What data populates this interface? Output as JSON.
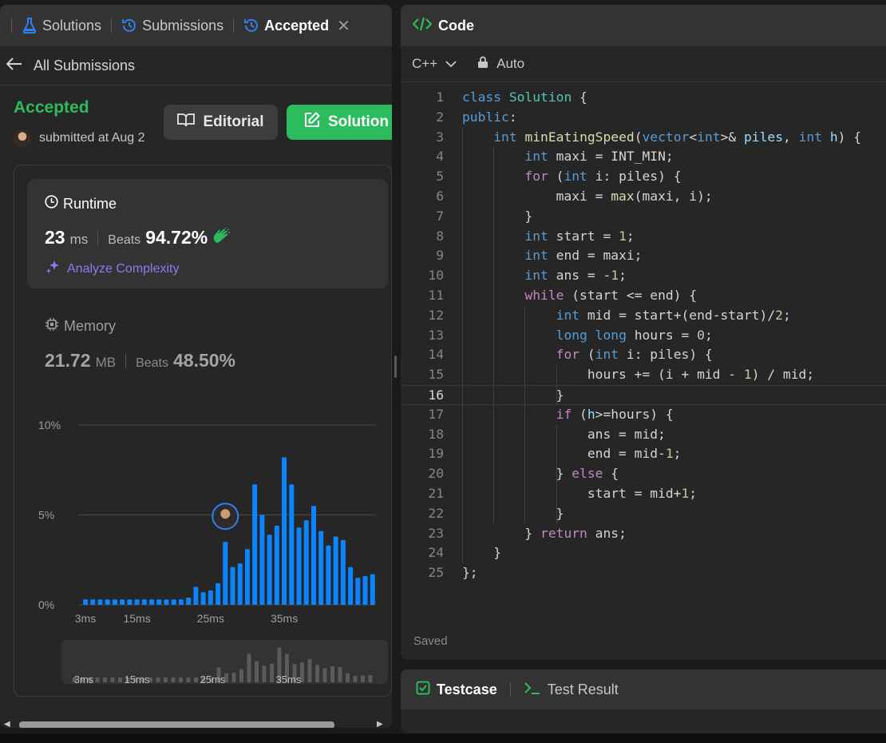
{
  "left_tabs": [
    {
      "label": "Solutions",
      "icon": "flask-icon"
    },
    {
      "label": "Submissions",
      "icon": "history-icon"
    },
    {
      "label": "Accepted",
      "icon": "history-icon",
      "active": true
    }
  ],
  "back": {
    "label": "All Submissions"
  },
  "submission": {
    "status": "Accepted",
    "status_color": "#2cbb5d",
    "submitted_text": "submitted at Aug 2",
    "editorial_label": "Editorial",
    "solution_label": "Solution"
  },
  "runtime": {
    "title": "Runtime",
    "value": "23",
    "unit": "ms",
    "beats_label": "Beats",
    "beats_value": "94.72%",
    "analyze_label": "Analyze Complexity"
  },
  "memory": {
    "title": "Memory",
    "value": "21.72",
    "unit": "MB",
    "beats_label": "Beats",
    "beats_value": "48.50%"
  },
  "chart_data": {
    "type": "bar",
    "title": "",
    "xlabel": "",
    "ylabel": "",
    "y_ticks": [
      "10%",
      "5%",
      "0%"
    ],
    "x_ticks": [
      "3ms",
      "15ms",
      "25ms",
      "35ms"
    ],
    "ylim": [
      0,
      10
    ],
    "values": [
      0.3,
      0.3,
      0.3,
      0.3,
      0.3,
      0.3,
      0.3,
      0.3,
      0.3,
      0.3,
      0.3,
      0.3,
      0.3,
      0.3,
      0.4,
      1.0,
      0.7,
      0.8,
      1.2,
      3.5,
      2.1,
      2.3,
      3.1,
      6.7,
      5.0,
      3.9,
      4.4,
      8.2,
      6.7,
      4.3,
      4.7,
      5.5,
      4.1,
      3.3,
      3.8,
      3.6,
      2.1,
      1.5,
      1.6,
      1.7
    ],
    "marker_index": 19,
    "bar_color": "#0a84ff"
  },
  "editor": {
    "title": "Code",
    "language": "C++",
    "mode": "Auto",
    "saved": "Saved",
    "current_line": 16,
    "lines": [
      "class Solution {",
      "public:",
      "    int minEatingSpeed(vector<int>& piles, int h) {",
      "        int maxi = INT_MIN;",
      "        for (int i: piles) {",
      "            maxi = max(maxi, i);",
      "        }",
      "        int start = 1;",
      "        int end = maxi;",
      "        int ans = -1;",
      "        while (start <= end) {",
      "            int mid = start+(end-start)/2;",
      "            long long hours = 0;",
      "            for (int i: piles) {",
      "                hours += (i + mid - 1) / mid;",
      "            }",
      "            if (h>=hours) {",
      "                ans = mid;",
      "                end = mid-1;",
      "            } else {",
      "                start = mid+1;",
      "            }",
      "        } return ans;",
      "    }",
      "};"
    ]
  },
  "testpanel": {
    "tab1": "Testcase",
    "tab2": "Test Result"
  }
}
